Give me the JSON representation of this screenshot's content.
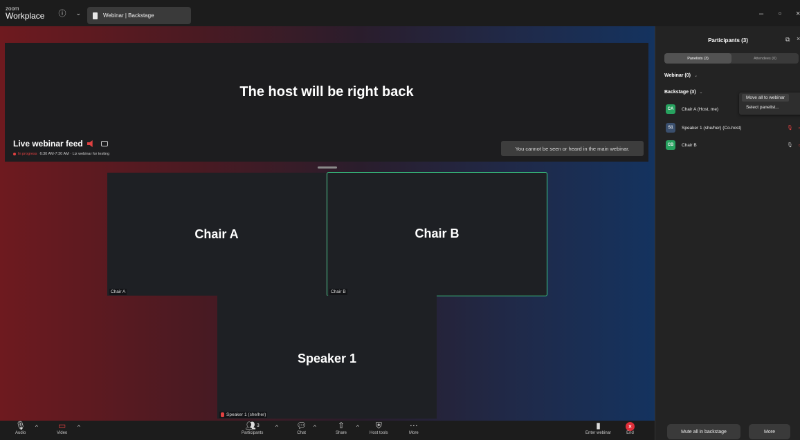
{
  "app": {
    "brand_small": "zoom",
    "brand": "Workplace",
    "tab_title": "Webinar | Backstage"
  },
  "feed": {
    "message": "The host will be right back",
    "title": "Live webinar feed",
    "status": "In progress",
    "details": "6:30 AM-7:30 AM · Liz webinar for testing",
    "notice": "You cannot be seen or heard in the main webinar."
  },
  "tiles": {
    "chair_a": {
      "name": "Chair A",
      "label": "Chair A"
    },
    "chair_b": {
      "name": "Chair B",
      "label": "Chair B"
    },
    "speaker": {
      "name": "Speaker 1",
      "label": "Speaker 1 (she/her)"
    }
  },
  "toolbar": {
    "audio": "Audio",
    "video": "Video",
    "participants": "Participants",
    "participants_count": "3",
    "chat": "Chat",
    "share": "Share",
    "host_tools": "Host tools",
    "more": "More",
    "enter_webinar": "Enter webinar",
    "end": "End"
  },
  "panel": {
    "title": "Participants (3)",
    "tabs": [
      "Panelists (3)",
      "Attendees (0)"
    ],
    "webinar_section": "Webinar (0)",
    "backstage_section": "Backstage (3)",
    "participants": [
      {
        "initials": "CA",
        "name": "Chair A (Host, me)"
      },
      {
        "initials": "S1",
        "name": "Speaker 1 (she/her) (Co-host)"
      },
      {
        "initials": "CB",
        "name": "Chair B"
      }
    ],
    "menu": [
      "Move all to webinar",
      "Select panelist..."
    ],
    "mute_all": "Mute all in backstage",
    "more": "More"
  },
  "colors": {
    "active_border": "#3bd18a",
    "end_red": "#e02f3a",
    "avatar_green": "#27a25f",
    "avatar_blue": "#3a4f6d",
    "muted_red": "#e14141"
  }
}
